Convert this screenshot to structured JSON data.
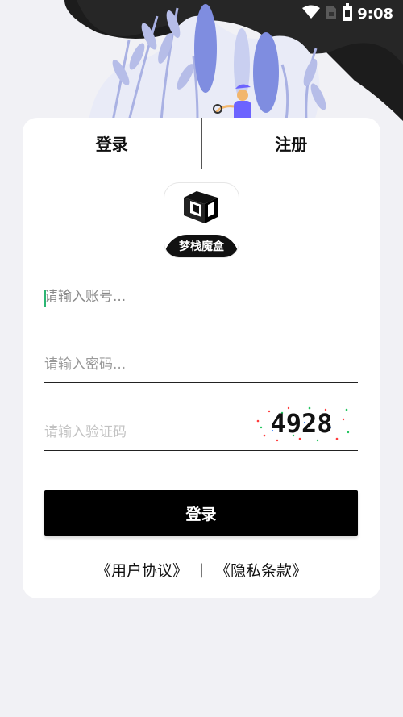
{
  "status_bar": {
    "time": "9:08",
    "icons": [
      "wifi-icon",
      "sim-card-icon",
      "battery-icon"
    ]
  },
  "tabs": [
    {
      "label": "登录"
    },
    {
      "label": "注册"
    }
  ],
  "logo": {
    "label": "梦栈魔盒"
  },
  "form": {
    "username_placeholder": "请输入账号...",
    "password_placeholder": "请输入密码...",
    "captcha_placeholder": "请输入验证码",
    "captcha_code": "4928"
  },
  "login_button": {
    "label": "登录"
  },
  "links": {
    "user_agreement": "《用户协议》",
    "separator": "|",
    "privacy_policy": "《隐私条款》"
  },
  "colors": {
    "background": "#f1f1f5",
    "primary_button": "#000000",
    "cursor": "#2bb673"
  }
}
